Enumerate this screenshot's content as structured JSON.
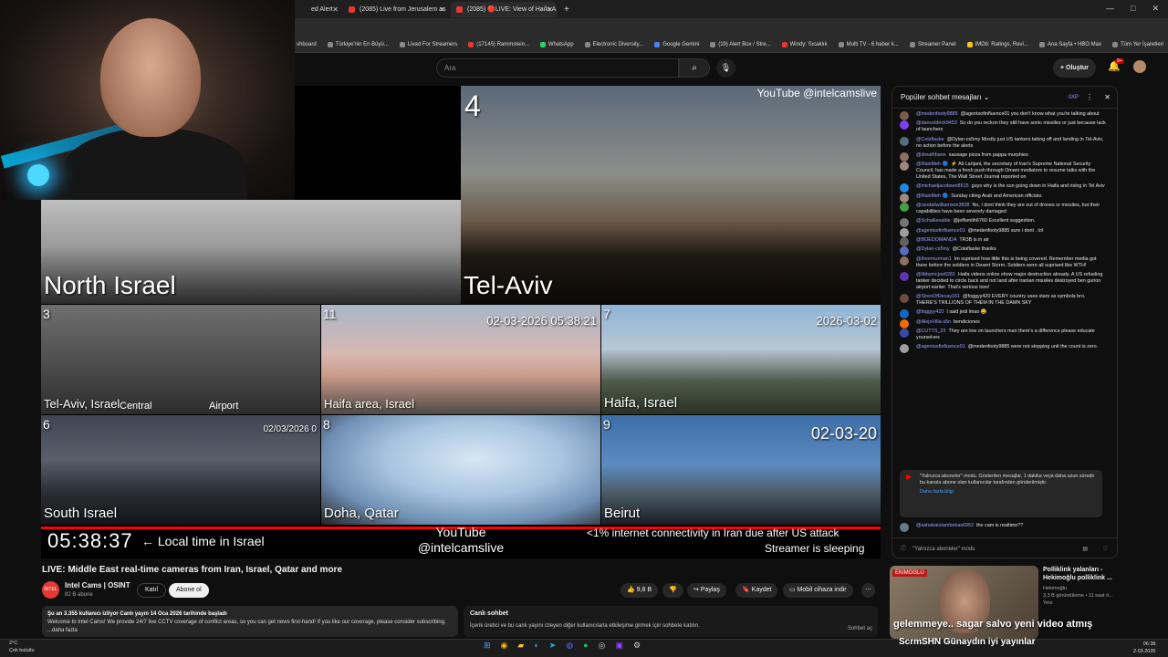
{
  "browser": {
    "tabs": [
      {
        "label": "ed Alert",
        "active": false
      },
      {
        "label": "(2085) Live from Jerusalem as a",
        "active": false
      },
      {
        "label": "(2085) 🔴LIVE: View of Haifa A",
        "active": true
      }
    ],
    "new_tab": "+",
    "window_controls": [
      "—",
      "□",
      "✕"
    ],
    "bookmarks": [
      "shboard",
      "Türkiye'nin En Büyü...",
      "Livad For Streamers",
      "(17145) Rammstein...",
      "WhatsApp",
      "Electronic Diversity...",
      "Google Gemini",
      "(19) Alert Box / Stre...",
      "Windy: Sıcaklık",
      "Multi TV - 6 haber k...",
      "Streamer Panel",
      "IMDb: Ratings, Revi...",
      "Ana Sayfa • HBO Max",
      "Tüm Yer İşaretleri"
    ]
  },
  "header": {
    "search_placeholder": "Ara",
    "create_label": "+ Oluştur",
    "notif_count": "9+"
  },
  "video": {
    "cams": [
      {
        "label": "North Israel",
        "num": "",
        "ts": ""
      },
      {
        "label": "Tel-Aviv",
        "num": "4",
        "ts": ""
      },
      {
        "label": "Tel-Aviv, Israel",
        "num": "3",
        "ts": "",
        "extra1": "Central",
        "extra2": "Airport"
      },
      {
        "label": "Haifa area, Israel",
        "num": "11",
        "ts": "02-03-2026 05:38:21"
      },
      {
        "label": "Haifa, Israel",
        "num": "7",
        "ts": "2026-03-02"
      },
      {
        "label": "South Israel",
        "num": "6",
        "ts": "02/03/2026 0"
      },
      {
        "label": "Doha, Qatar",
        "num": "8",
        "ts": ""
      },
      {
        "label": "Beirut",
        "num": "9",
        "ts": "02-03-20"
      }
    ],
    "watermark_top": "YouTube @intelcamslive",
    "clock": "05:38:37",
    "clock_label": "← Local time in Israel",
    "watermark_bottom_1": "YouTube",
    "watermark_bottom_2": "@intelcamslive",
    "ticker": "<1% internet connectivity in Iran due after US attack",
    "sleep_text": "Streamer is sleeping",
    "progress": 1.0,
    "live_label": "Canlı"
  },
  "info": {
    "title": "LIVE: Middle East real-time cameras from Iran, Israel, Qatar and more",
    "channel": "Intel Cams | OSINT",
    "subs": "82 B abone",
    "join": "Katıl",
    "subscribe": "Abone ol",
    "likes": "9,8 B",
    "share": "Paylaş",
    "save": "Kaydet",
    "download": "Mobil cihaza indir",
    "more": "⋯",
    "desc_line1": "Şu an 3.355 kullanıcı izliyor  Canlı yayın 14 Oca 2026 tarihinde başladı",
    "desc_line2": "Welcome to Intel Cams! We provide 24/7 live CCTV coverage of conflict areas, so you can get news first-hand! If you like our coverage, please consider subscribing.",
    "desc_more": "...daha fazla",
    "live_chat_title": "Canlı sohbet",
    "live_chat_text": "İçerik üretici ve bu canlı yayını izleyen diğer kullanıcılarla etkileşime girmek için sohbete katılın.",
    "live_chat_button": "Sohbet aç"
  },
  "chat": {
    "header": "Popüler sohbet mesajları",
    "xp_label": "0XP",
    "messages": [
      {
        "author": "@medenfooty9885",
        "text": "@agentsofinfluence01 you don't know what you're talking about",
        "color": "#7b5a4a"
      },
      {
        "author": "@dancoldrick9453",
        "text": "So do you reckon they still have sonic missiles or just because lack of launchers",
        "color": "#7e3ff2"
      },
      {
        "author": "@Colaflaske",
        "text": "@Dylan-cs5my Mostly just US tankers taking off and landing in Tel-Aviv, no action before the alerts",
        "color": "#546e7a"
      },
      {
        "author": "@dreathbane",
        "text": "sausage pizza from pappa murphies",
        "color": "#8d6e63"
      },
      {
        "author": "@RainMeh 🔵",
        "text": "⚡ Ali Larijani, the secretary of Iran's Supreme National Security Council, has made a fresh push through Omani mediators to resume talks with the United States, The Wall Street Journal reported on",
        "color": "#a1887f"
      },
      {
        "author": "@michaeljacobsen8515",
        "text": "guys why is the sun going down in Haifa and rising in Tel Aviv",
        "color": "#1e88e5"
      },
      {
        "author": "@RainMeh 🔵",
        "text": "Sunday citing Arab and American officials.",
        "color": "#a1887f"
      },
      {
        "author": "@randallwilliamson3838",
        "text": "No, I dont think they are out of drones or missiles, but their capabilities have been severely damaged",
        "color": "#43a047"
      },
      {
        "author": "@Schalkesable",
        "text": "@jeffsmith6760 Excellent suggestion.",
        "color": "#757575"
      },
      {
        "author": "@agentsofinfluence01",
        "text": "@medenfooty9885 sure i dont . lol",
        "color": "#9e9e9e"
      },
      {
        "author": "@BOEDOMANDA",
        "text": "TR3B is in air",
        "color": "#616161"
      },
      {
        "author": "@Dylan-cs5my",
        "text": "@Colaflaske thanks",
        "color": "#5c6bc0"
      },
      {
        "author": "@theemurman1",
        "text": "Im suprised how little this is being covered. Remember media got there before the soldiers in Desert Storm. Soldiers were all suprised like WTH!",
        "color": "#8d6e63"
      },
      {
        "author": "@libbymcjoe6281",
        "text": "Haifa videos online show major destruction already. A US refueling tanker decided to circle back and not land after iranian missiles destroyed ben gurion airport earlier. That's serious loss!",
        "color": "#5e35b1"
      },
      {
        "author": "@SirenOfDecay161",
        "text": "@foggyy420 EVERY country uses stars as symbols bro. THERE'S TRILLIONS OF THEM IN THE DAMN SKY",
        "color": "#6d4c41"
      },
      {
        "author": "@foggyy420",
        "text": "I said jedi lmao 😂",
        "color": "#1565c0"
      },
      {
        "author": "@AlejoVilla-s5n",
        "text": "bendiciones",
        "color": "#ef6c00"
      },
      {
        "author": "@CUTTS_23",
        "text": "They are low on launchers man there's a difference please educate yourselves",
        "color": "#3949ab"
      },
      {
        "author": "@agentsofinfluence01",
        "text": "@medenfooty9885 were not stopping unit the count is zero.",
        "color": "#9e9e9e"
      }
    ],
    "mode_notice": "\"Yalnızca aboneler\" modu. Gösterilen mesajlar, 1 dakika veya daha uzun süredir bu kanala abone olan kullanıcılar tarafından gönderilmiştir.",
    "mode_more": "Daha fazla bilgi",
    "last_author": "@sahabatalambebas6952",
    "last_text": "the cam is realtime??",
    "footer": "\"Yalnızca aboneler\" modu"
  },
  "recommended": {
    "badge": "EKIMOGLU",
    "title": "Polliklink yalanları - Hekimoğlu polliklink ...",
    "channel": "Hekimoğlu",
    "meta": "3,3 B görüntüleme • 11 saat ö...",
    "tag": "Yeni",
    "overlay": "gelemmeye.. sagar salvo yeni video atmış"
  },
  "banner": "ScrmSHN  Günaydın iyi yayınlar",
  "taskbar": {
    "weather_temp": "2°C",
    "weather_text": "Çok bulutlu",
    "time": "06:38",
    "date": "2.03.2026"
  },
  "colors": {
    "accent": "#ff0000",
    "bg": "#0f0f0f"
  }
}
